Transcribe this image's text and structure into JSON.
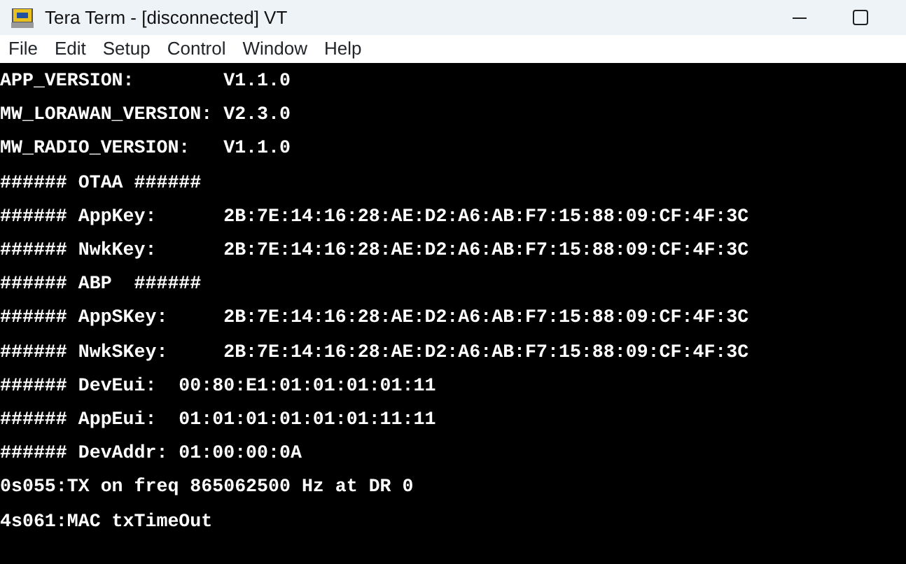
{
  "window": {
    "title": "Tera Term - [disconnected] VT"
  },
  "menu": [
    "File",
    "Edit",
    "Setup",
    "Control",
    "Window",
    "Help"
  ],
  "terminal": {
    "lines": [
      "APP_VERSION:        V1.1.0",
      "MW_LORAWAN_VERSION: V2.3.0",
      "MW_RADIO_VERSION:   V1.1.0",
      "###### OTAA ######",
      "###### AppKey:      2B:7E:14:16:28:AE:D2:A6:AB:F7:15:88:09:CF:4F:3C",
      "###### NwkKey:      2B:7E:14:16:28:AE:D2:A6:AB:F7:15:88:09:CF:4F:3C",
      "###### ABP  ######",
      "###### AppSKey:     2B:7E:14:16:28:AE:D2:A6:AB:F7:15:88:09:CF:4F:3C",
      "###### NwkSKey:     2B:7E:14:16:28:AE:D2:A6:AB:F7:15:88:09:CF:4F:3C",
      "###### DevEui:  00:80:E1:01:01:01:01:11",
      "###### AppEui:  01:01:01:01:01:01:11:11",
      "###### DevAddr: 01:00:00:0A",
      "0s055:TX on freq 865062500 Hz at DR 0",
      "4s061:MAC txTimeOut"
    ]
  }
}
